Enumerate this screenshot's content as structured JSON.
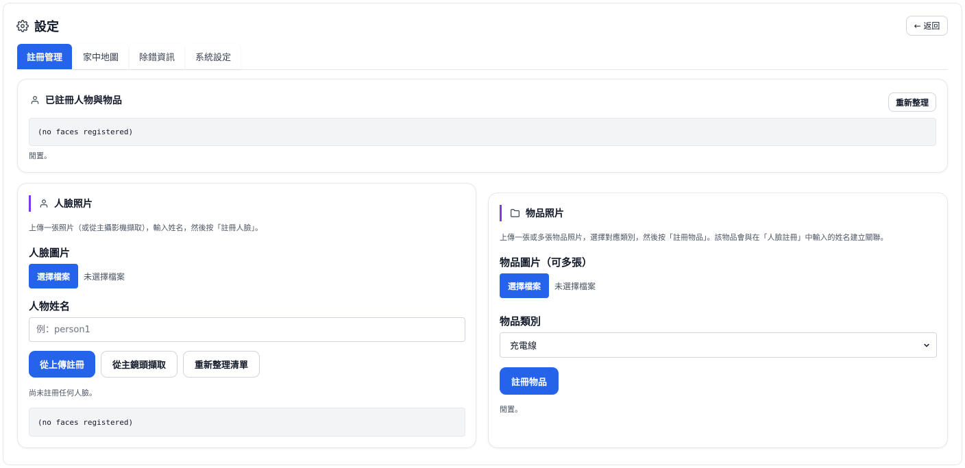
{
  "header": {
    "title": "設定",
    "back_label": "← 返回"
  },
  "tabs": [
    {
      "label": "註冊管理",
      "active": true
    },
    {
      "label": "家中地圖",
      "active": false
    },
    {
      "label": "除錯資訊",
      "active": false
    },
    {
      "label": "系統設定",
      "active": false
    }
  ],
  "registered": {
    "title": "已註冊人物與物品",
    "refresh_label": "重新整理",
    "list_text": "(no faces registered)",
    "status": "閒置。"
  },
  "face": {
    "title": "人臉照片",
    "description": "上傳一張照片（或從主攝影機擷取），輸入姓名，然後按「註冊人臉」。",
    "image_label": "人臉圖片",
    "file_button": "選擇檔案",
    "file_status": "未選擇檔案",
    "name_label": "人物姓名",
    "name_placeholder": "例：person1",
    "buttons": {
      "upload": "從上傳註冊",
      "capture": "從主鏡頭擷取",
      "refresh": "重新整理清單"
    },
    "status": "尚未註冊任何人臉。",
    "list_text": "(no faces registered)"
  },
  "item": {
    "title": "物品照片",
    "description": "上傳一張或多張物品照片，選擇對應類別，然後按「註冊物品」。該物品會與在「人臉註冊」中輸入的姓名建立關聯。",
    "image_label": "物品圖片（可多張）",
    "file_button": "選擇檔案",
    "file_status": "未選擇檔案",
    "category_label": "物品類別",
    "category_selected": "充電線",
    "register_button": "註冊物品",
    "status": "閒置。"
  },
  "colors": {
    "primary": "#2563eb",
    "accent": "#7c3aed",
    "border": "#e5e7eb"
  },
  "icons": {
    "header": "gear-icon",
    "registered": "person-icon",
    "face": "person-icon",
    "item": "folder-icon",
    "select": "chevron-down-icon"
  }
}
